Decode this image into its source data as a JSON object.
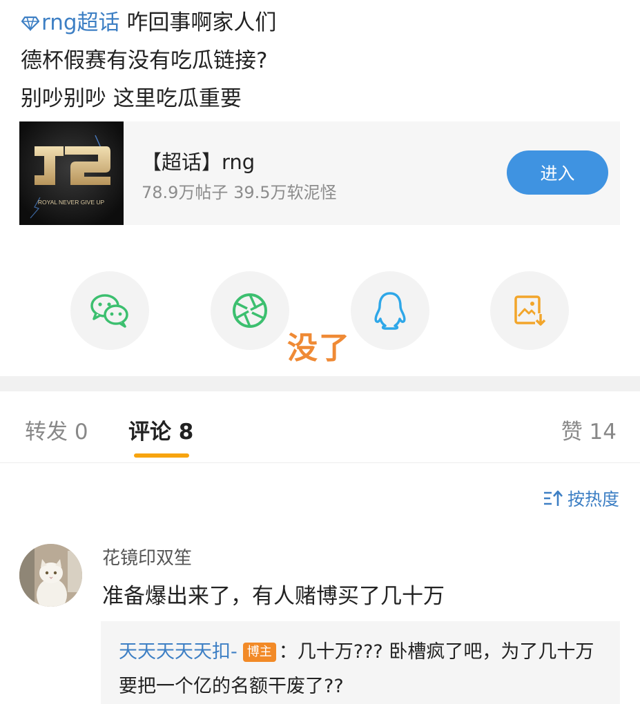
{
  "post": {
    "topic_tag": "rng超话",
    "line1_rest": " 咋回事啊家人们",
    "line2": "德杯假赛有没有吃瓜链接?",
    "line3": "别吵别吵 这里吃瓜重要"
  },
  "topic_card": {
    "logo_text": "ROYAL NEVER GIVE UP",
    "title": "【超话】rng",
    "stats": "78.9万帖子 39.5万软泥怪",
    "enter_label": "进入"
  },
  "share": {
    "icons": [
      "wechat-icon",
      "moments-icon",
      "qq-icon",
      "save-image-icon"
    ],
    "overlay_text": "没了"
  },
  "tabs": {
    "repost": "转发 0",
    "comments": "评论 8",
    "likes": "赞 14"
  },
  "sort": {
    "label": "按热度"
  },
  "comment": {
    "author": "花镜印双笙",
    "body": "准备爆出来了，有人赌博买了几十万",
    "reply": {
      "author": "天天天天天扣-",
      "badge": "博主",
      "text": "：几十万??? 卧槽疯了吧，为了几十万要把一个亿的名额干废了??"
    }
  },
  "colors": {
    "link": "#3d7fc4",
    "accent_orange": "#f7a40f",
    "enter_button": "#3f93e1",
    "wechat_green": "#3cbf6f",
    "qq_blue": "#2ea7e8",
    "save_orange": "#f2a52a"
  }
}
